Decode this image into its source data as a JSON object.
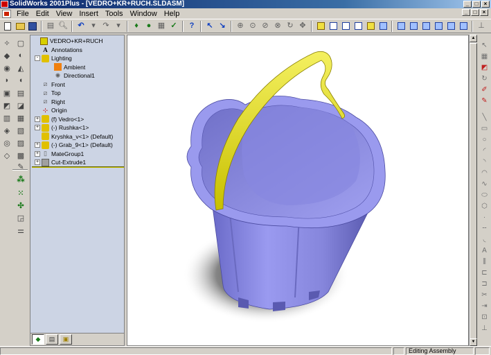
{
  "window": {
    "title": "SolidWorks 2001Plus - [VEDRO+KR+RUCH.SLDASM]",
    "app_icon_label": "SW",
    "minimize": "_",
    "maximize": "□",
    "close": "×"
  },
  "menu": {
    "items": [
      "File",
      "Edit",
      "View",
      "Insert",
      "Tools",
      "Window",
      "Help"
    ]
  },
  "toolbar": {
    "icons": [
      "new-icon",
      "open-icon",
      "save-icon",
      "print-icon",
      "print-preview-icon",
      "undo-icon",
      "redo-icon",
      "rebuild-icon",
      "options-icon",
      "whats-wrong-icon",
      "help-icon",
      "select-icon",
      "zoom-fit-icon",
      "zoom-area-icon",
      "zoom-in-out-icon",
      "zoom-selection-icon",
      "rotate-view-icon",
      "pan-icon",
      "wireframe-icon",
      "hidden-lines-icon",
      "hidden-removed-icon",
      "shaded-icon",
      "shadow-icon",
      "perspective-icon",
      "front-view-icon",
      "back-view-icon",
      "left-view-icon",
      "right-view-icon",
      "top-view-icon",
      "isometric-icon",
      "normal-to-icon"
    ]
  },
  "tree": {
    "root": "VEDRO+KR+RUCH",
    "items": [
      {
        "label": "Annotations",
        "icon": "annotations-icon"
      },
      {
        "label": "Lighting",
        "icon": "lighting-icon"
      },
      {
        "label": "Ambient",
        "icon": "ambient-light-icon"
      },
      {
        "label": "Directional1",
        "icon": "directional-light-icon"
      },
      {
        "label": "Front",
        "icon": "plane-icon"
      },
      {
        "label": "Top",
        "icon": "plane-icon"
      },
      {
        "label": "Right",
        "icon": "plane-icon"
      },
      {
        "label": "Origin",
        "icon": "origin-icon"
      },
      {
        "label": "(f) Vedro<1>",
        "icon": "part-icon"
      },
      {
        "label": "(-) Rushka<1>",
        "icon": "part-icon"
      },
      {
        "label": "Kryshka_v<1> (Default)",
        "icon": "part-icon"
      },
      {
        "label": "(-) Grab_9<1> (Default)",
        "icon": "part-icon"
      },
      {
        "label": "MateGroup1",
        "icon": "mate-group-icon"
      },
      {
        "label": "Cut-Extrude1",
        "icon": "cut-extrude-icon"
      }
    ]
  },
  "panel_tabs": [
    "feature-manager-tab-icon",
    "property-manager-tab-icon",
    "configuration-manager-tab-icon"
  ],
  "status": {
    "message": "",
    "mode": "Editing Assembly"
  },
  "colors": {
    "bucket": "#8e8ee0",
    "handle": "#e8e020",
    "tree_background": "#ccd4e4"
  }
}
